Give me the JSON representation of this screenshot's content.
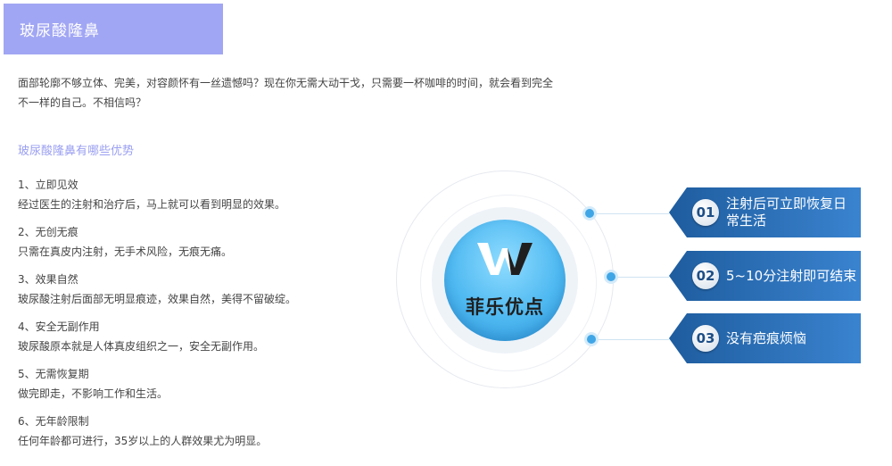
{
  "title": "玻尿酸隆鼻",
  "intro": {
    "line1": "面部轮廓不够立体、完美，对容颜怀有一丝遗憾吗？现在你无需大动干戈，只需要一杯咖啡的时间，就会看到完全",
    "line2": "不一样的自己。不相信吗？"
  },
  "subheading": "玻尿酸隆鼻有哪些优势",
  "advantages": [
    {
      "head": "1、立即见效",
      "desc": "经过医生的注射和治疗后，马上就可以看到明显的效果。"
    },
    {
      "head": "2、无创无痕",
      "desc": "只需在真皮内注射，无手术风险，无痕无痛。"
    },
    {
      "head": "3、效果自然",
      "desc": "玻尿酸注射后面部无明显痕迹，效果自然，美得不留破绽。"
    },
    {
      "head": "4、安全无副作用",
      "desc": "玻尿酸原本就是人体真皮组织之一，安全无副作用。"
    },
    {
      "head": "5、无需恢复期",
      "desc": "做完即走，不影响工作和生活。"
    },
    {
      "head": "6、无年龄限制",
      "desc": "任何年龄都可进行，35岁以上的人群效果尤为明显。"
    }
  ],
  "graphic": {
    "center_label": "菲乐优点",
    "logo_icon": "w-logo-icon",
    "badges": [
      {
        "num": "01",
        "text": "注射后可立即恢复日常生活"
      },
      {
        "num": "02",
        "text": "5~10分注射即可结束"
      },
      {
        "num": "03",
        "text": "没有疤痕烦恼"
      }
    ]
  },
  "colors": {
    "title_bg": "#a1a6f4",
    "subheading": "#9a9ff1",
    "badge_blue": "#2f74bf",
    "dot_blue": "#40a6e6"
  }
}
